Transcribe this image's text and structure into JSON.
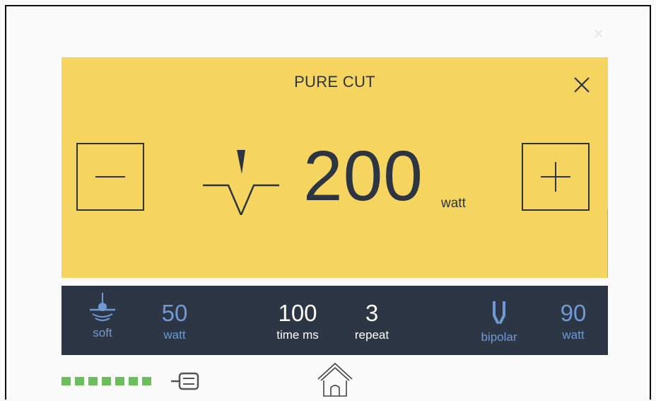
{
  "panel": {
    "title": "PURE CUT",
    "power_value": "200",
    "power_unit": "watt"
  },
  "bar": {
    "coag_mode": "soft",
    "coag_value": "50",
    "coag_unit": "watt",
    "time_value": "100",
    "time_label": "time ms",
    "repeat_value": "3",
    "repeat_label": "repeat",
    "bipolar_label": "bipolar",
    "bipolar_value": "90",
    "bipolar_unit": "watt"
  },
  "status": {
    "led_count": 7,
    "led_color": "#6bbf5a"
  },
  "colors": {
    "panel_bg": "#f5d55f",
    "bar_bg": "#2d3644",
    "accent_blue": "#6f9ad6",
    "text_dark": "#2d3442"
  },
  "icons": {
    "close": "close-icon",
    "minus": "minus-icon",
    "plus": "plus-icon",
    "cut_waveform": "cut-waveform-icon",
    "soft_coag": "soft-coag-electrode-icon",
    "bipolar": "bipolar-forceps-icon",
    "plug": "plug-connector-icon",
    "home": "home-icon"
  }
}
